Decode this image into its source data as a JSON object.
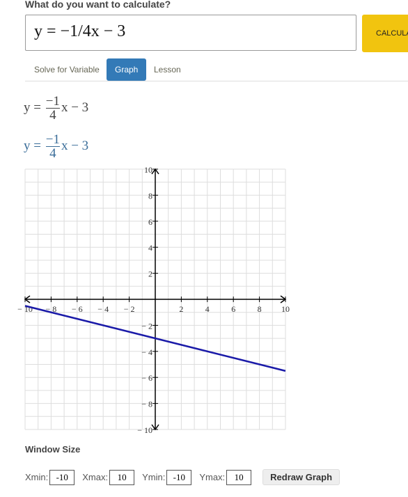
{
  "prompt": "What do you want to calculate?",
  "input_value": "y = −1/4x − 3",
  "calculate_label": "CALCULATE",
  "tabs": [
    {
      "label": "Solve for Variable"
    },
    {
      "label": "Graph",
      "active": true
    },
    {
      "label": "Lesson"
    }
  ],
  "equation": {
    "lhs": "y =",
    "num": "−1",
    "den": "4",
    "rest": "x − 3"
  },
  "window": {
    "title": "Window Size",
    "xmin_label": "Xmin:",
    "xmin": "-10",
    "xmax_label": "Xmax:",
    "xmax": "10",
    "ymin_label": "Ymin:",
    "ymin": "-10",
    "ymax_label": "Ymax:",
    "ymax": "10",
    "redraw_label": "Redraw Graph"
  },
  "chart_data": {
    "type": "line",
    "xlim": [
      -10,
      10
    ],
    "ylim": [
      -10,
      10
    ],
    "grid": true,
    "xticks": [
      -10,
      -8,
      -6,
      -4,
      -2,
      2,
      4,
      6,
      8,
      10
    ],
    "yticks": [
      -10,
      -8,
      -6,
      -4,
      -2,
      2,
      4,
      6,
      8,
      10
    ],
    "series": [
      {
        "slope": -0.25,
        "intercept": -3,
        "x": [
          -10,
          10
        ],
        "y": [
          -0.5,
          -5.5
        ],
        "color": "#1a1aa8"
      }
    ]
  }
}
